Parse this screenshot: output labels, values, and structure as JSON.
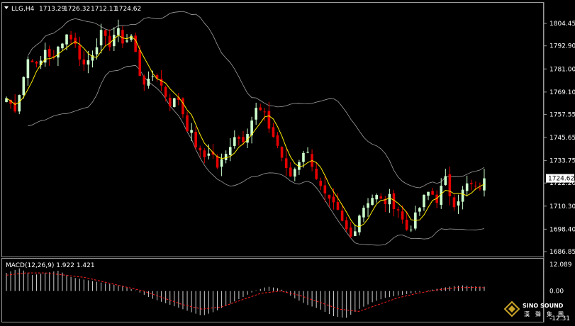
{
  "chart_data": [
    {
      "type": "candlestick",
      "header": {
        "symbol": "LLG,H4",
        "open": "1713.29",
        "high": "1726.32",
        "low": "1712.11",
        "close": "1724.62"
      },
      "y_ticks": [
        "1804.45",
        "1792.90",
        "1781.00",
        "1769.10",
        "1757.55",
        "1745.65",
        "1733.75",
        "1722.20",
        "1710.30",
        "1698.40",
        "1686.85"
      ],
      "ylim": [
        1686.85,
        1810.0
      ],
      "current_price_label": "1724.62",
      "close_path": [
        [
          0,
          1766
        ],
        [
          6,
          1760
        ],
        [
          12,
          1774
        ],
        [
          18,
          1790
        ],
        [
          24,
          1780
        ],
        [
          30,
          1792
        ],
        [
          36,
          1785
        ],
        [
          42,
          1796
        ],
        [
          48,
          1800
        ],
        [
          54,
          1791
        ],
        [
          60,
          1782
        ],
        [
          66,
          1790
        ],
        [
          72,
          1799
        ],
        [
          78,
          1793
        ],
        [
          84,
          1801
        ],
        [
          90,
          1795
        ],
        [
          96,
          1798
        ],
        [
          102,
          1779
        ],
        [
          108,
          1772
        ],
        [
          114,
          1780
        ],
        [
          120,
          1770
        ],
        [
          126,
          1763
        ],
        [
          132,
          1766
        ],
        [
          138,
          1752
        ],
        [
          144,
          1744
        ],
        [
          150,
          1734
        ],
        [
          156,
          1740
        ],
        [
          162,
          1730
        ],
        [
          168,
          1736
        ],
        [
          174,
          1748
        ],
        [
          180,
          1744
        ],
        [
          186,
          1752
        ],
        [
          192,
          1761
        ],
        [
          198,
          1756
        ],
        [
          204,
          1747
        ],
        [
          210,
          1738
        ],
        [
          216,
          1724
        ],
        [
          222,
          1731
        ],
        [
          228,
          1740
        ],
        [
          234,
          1733
        ],
        [
          240,
          1720
        ],
        [
          246,
          1712
        ],
        [
          252,
          1709
        ],
        [
          258,
          1700
        ],
        [
          264,
          1694
        ],
        [
          270,
          1706
        ],
        [
          276,
          1713
        ],
        [
          282,
          1716
        ],
        [
          288,
          1712
        ],
        [
          294,
          1714
        ],
        [
          300,
          1709
        ],
        [
          306,
          1698
        ],
        [
          312,
          1702
        ],
        [
          318,
          1712
        ],
        [
          324,
          1718
        ],
        [
          330,
          1714
        ],
        [
          336,
          1724
        ],
        [
          342,
          1712
        ],
        [
          348,
          1716
        ],
        [
          354,
          1722
        ],
        [
          360,
          1718
        ],
        [
          366,
          1724.62
        ]
      ],
      "macd": {
        "label": "MACD(12,26,9) 1.922 1.421",
        "y_ticks": [
          "12.089",
          "0.00",
          "-12.31"
        ],
        "ylim": [
          -12.31,
          12.089
        ],
        "histogram_path": [
          [
            0,
            8
          ],
          [
            10,
            10
          ],
          [
            20,
            7
          ],
          [
            30,
            8
          ],
          [
            40,
            9
          ],
          [
            50,
            6
          ],
          [
            60,
            5
          ],
          [
            70,
            4
          ],
          [
            80,
            3
          ],
          [
            90,
            2
          ],
          [
            100,
            0
          ],
          [
            110,
            -3
          ],
          [
            120,
            -5
          ],
          [
            130,
            -7
          ],
          [
            140,
            -9
          ],
          [
            150,
            -11
          ],
          [
            160,
            -9
          ],
          [
            170,
            -6
          ],
          [
            180,
            -3
          ],
          [
            190,
            0
          ],
          [
            200,
            2
          ],
          [
            210,
            1
          ],
          [
            220,
            -3
          ],
          [
            230,
            -6
          ],
          [
            240,
            -8
          ],
          [
            250,
            -11
          ],
          [
            260,
            -12
          ],
          [
            270,
            -8
          ],
          [
            280,
            -5
          ],
          [
            290,
            -3
          ],
          [
            300,
            -2
          ],
          [
            310,
            -1
          ],
          [
            320,
            0
          ],
          [
            330,
            1
          ],
          [
            340,
            2
          ],
          [
            350,
            2.5
          ],
          [
            360,
            2
          ],
          [
            366,
            1.922
          ]
        ],
        "signal_path": [
          [
            0,
            7
          ],
          [
            15,
            8
          ],
          [
            30,
            8
          ],
          [
            45,
            7
          ],
          [
            60,
            6
          ],
          [
            75,
            4
          ],
          [
            90,
            2
          ],
          [
            105,
            0
          ],
          [
            120,
            -3
          ],
          [
            135,
            -6
          ],
          [
            150,
            -8
          ],
          [
            165,
            -7
          ],
          [
            180,
            -4
          ],
          [
            195,
            -1
          ],
          [
            210,
            0
          ],
          [
            225,
            -2
          ],
          [
            240,
            -5
          ],
          [
            255,
            -8
          ],
          [
            270,
            -9
          ],
          [
            285,
            -6
          ],
          [
            300,
            -3
          ],
          [
            315,
            -1
          ],
          [
            330,
            0.5
          ],
          [
            345,
            1.5
          ],
          [
            360,
            1.6
          ],
          [
            366,
            1.421
          ]
        ]
      }
    }
  ],
  "logo": {
    "brand": "SINO SOUND",
    "chars": [
      "漢",
      "聲",
      "集",
      "團"
    ]
  }
}
